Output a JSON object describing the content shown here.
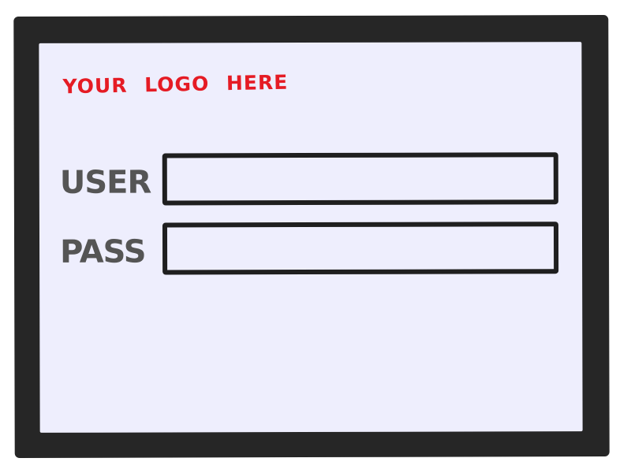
{
  "header": {
    "logo_text": "YOUR LOGO HERE",
    "logo_color": "#e51b24"
  },
  "form": {
    "user_label": "USER",
    "user_value": "",
    "pass_label": "PASS",
    "pass_value": ""
  },
  "colors": {
    "frame": "#262626",
    "screen_background": "#eeeefd",
    "label_text": "#555555",
    "input_border": "#1f1f1f"
  }
}
